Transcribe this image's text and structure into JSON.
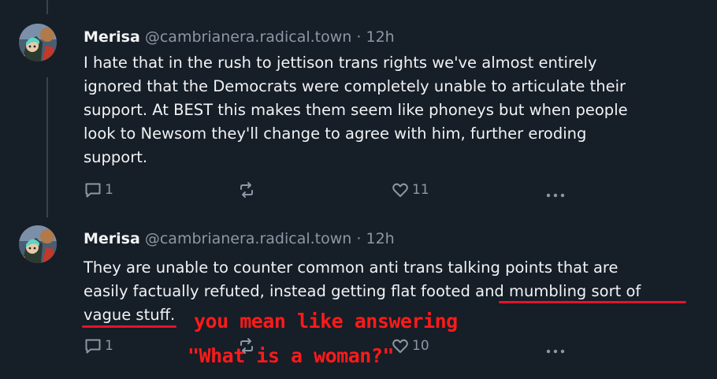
{
  "posts": [
    {
      "author": "Merisa",
      "handle": "@cambrianera.radical.town",
      "separator": "·",
      "time": "12h",
      "lines": [
        "I hate that in the rush to jettison trans rights we've almost entirely",
        "ignored that the Democrats were completely unable to articulate their",
        "support. At BEST this makes them seem like phoneys but when people",
        "look to Newsom they'll change to agree with him, further eroding",
        "support."
      ],
      "replies": "1",
      "likes": "11"
    },
    {
      "author": "Merisa",
      "handle": "@cambrianera.radical.town",
      "separator": "·",
      "time": "12h",
      "line1": "They are unable to counter common anti trans talking points that are",
      "line2_before": "easily factually refuted, instead getting flat footed ",
      "line2_underlined": "and mumbling sort of",
      "line3_underlined": "vague stuff",
      "line3_after": ".",
      "replies": "1",
      "likes": "10"
    }
  ],
  "annotation": {
    "line1": "you mean like answering",
    "line2": "\"What is a woman?\""
  },
  "colors": {
    "background": "#161e27",
    "text": "#f1f3f5",
    "muted": "#8b98a5",
    "annotation": "#ff1a1a"
  },
  "icons": {
    "reply": "speech-bubble-icon",
    "repost": "repost-arrows-icon",
    "like": "heart-icon",
    "more": "more-dots-icon",
    "avatar": "avatar-illustration"
  }
}
